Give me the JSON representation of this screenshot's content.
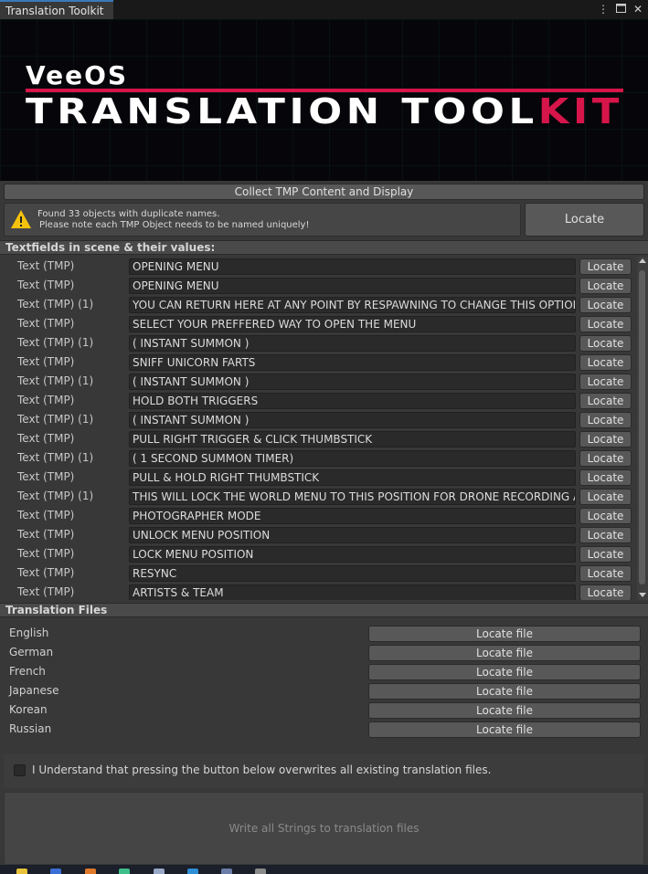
{
  "window": {
    "tab_title": "Translation Toolkit"
  },
  "titlebar_icons": [
    "more-icon",
    "maximize-icon",
    "close-icon"
  ],
  "banner": {
    "brand": "VeeOS",
    "line_a": "TRANSLATION TOOL",
    "line_b": "KIT"
  },
  "collect_button": "Collect TMP Content and Display",
  "warning": {
    "line1": "Found 33 objects with duplicate names.",
    "line2": "Please note each TMP Object needs to be named uniquely!",
    "locate_label": "Locate"
  },
  "textfields": {
    "header": "Textfields in scene & their values:",
    "locate_label": "Locate",
    "rows": [
      {
        "name": "Text (TMP)",
        "value": "OPENING MENU"
      },
      {
        "name": "Text (TMP)",
        "value": "OPENING MENU"
      },
      {
        "name": "Text (TMP) (1)",
        "value": "YOU CAN RETURN HERE AT ANY POINT BY RESPAWNING TO CHANGE THIS OPTION"
      },
      {
        "name": "Text (TMP)",
        "value": "SELECT YOUR PREFFERED WAY TO OPEN THE MENU"
      },
      {
        "name": "Text (TMP) (1)",
        "value": "( INSTANT SUMMON )"
      },
      {
        "name": "Text (TMP)",
        "value": "SNIFF UNICORN FARTS"
      },
      {
        "name": "Text (TMP) (1)",
        "value": "( INSTANT SUMMON )"
      },
      {
        "name": "Text (TMP)",
        "value": "HOLD BOTH TRIGGERS"
      },
      {
        "name": "Text (TMP) (1)",
        "value": "( INSTANT SUMMON )"
      },
      {
        "name": "Text (TMP)",
        "value": "PULL RIGHT TRIGGER & CLICK THUMBSTICK"
      },
      {
        "name": "Text (TMP) (1)",
        "value": "( 1 SECOND SUMMON TIMER)"
      },
      {
        "name": "Text (TMP)",
        "value": "PULL & HOLD RIGHT THUMBSTICK"
      },
      {
        "name": "Text (TMP) (1)",
        "value": "THIS WILL LOCK THE WORLD MENU TO THIS POSITION FOR DRONE RECORDING AN"
      },
      {
        "name": "Text (TMP)",
        "value": "PHOTOGRAPHER MODE"
      },
      {
        "name": "Text (TMP)",
        "value": "UNLOCK MENU POSITION"
      },
      {
        "name": "Text (TMP)",
        "value": "LOCK MENU POSITION"
      },
      {
        "name": "Text (TMP)",
        "value": "RESYNC"
      },
      {
        "name": "Text (TMP)",
        "value": "ARTISTS & TEAM"
      }
    ]
  },
  "translation_files": {
    "header": "Translation Files",
    "button_label": "Locate file",
    "languages": [
      "English",
      "German",
      "French",
      "Japanese",
      "Korean",
      "Russian"
    ]
  },
  "confirm": {
    "label": "I Understand that pressing the button below overwrites all existing translation files.",
    "checked": false
  },
  "write_button": "Write all Strings to translation files",
  "colors": {
    "accent": "#d6154a",
    "tab_accent": "#3a79bb",
    "warning": "#f4c20d"
  }
}
